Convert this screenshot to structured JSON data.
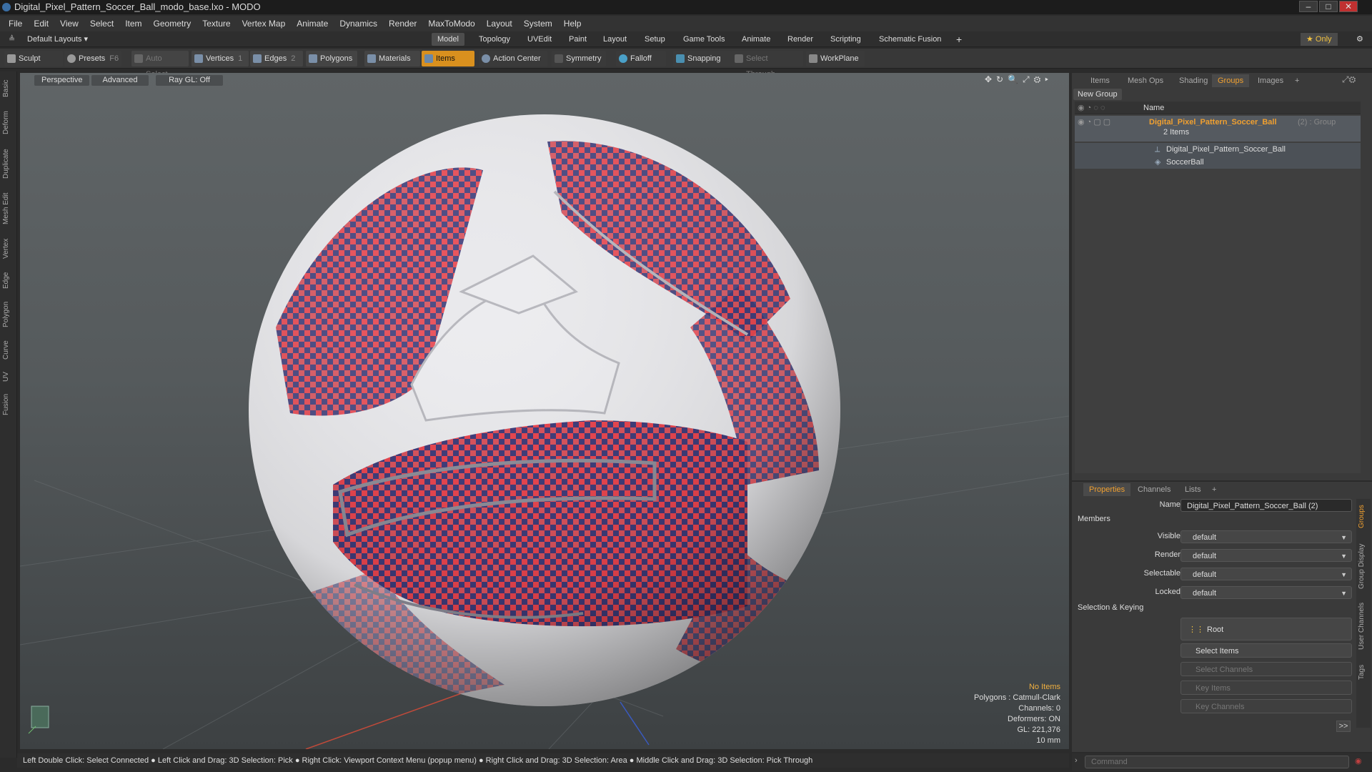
{
  "title": "Digital_Pixel_Pattern_Soccer_Ball_modo_base.lxo - MODO",
  "menu": [
    "File",
    "Edit",
    "View",
    "Select",
    "Item",
    "Geometry",
    "Texture",
    "Vertex Map",
    "Animate",
    "Dynamics",
    "Render",
    "MaxToModo",
    "Layout",
    "System",
    "Help"
  ],
  "layouts": {
    "default": "Default Layouts ▾",
    "only": "★ Only"
  },
  "layout_tabs": [
    "Model",
    "Topology",
    "UVEdit",
    "Paint",
    "Layout",
    "Setup",
    "Game Tools",
    "Animate",
    "Render",
    "Scripting",
    "Schematic Fusion",
    "+"
  ],
  "toolbar": {
    "sculpt": "Sculpt",
    "presets": "Presets",
    "presets_key": "F6",
    "auto_select": "Auto Select",
    "vertices": "Vertices",
    "vertices_count": "1",
    "edges": "Edges",
    "edges_count": "2",
    "polygons": "Polygons",
    "materials": "Materials",
    "items": "Items",
    "action_center": "Action Center",
    "symmetry": "Symmetry",
    "falloff": "Falloff",
    "snapping": "Snapping",
    "select_through": "Select Through",
    "workplane": "WorkPlane"
  },
  "left_tabs": [
    "Basic",
    "Deform",
    "Duplicate",
    "Mesh Edit",
    "Vertex",
    "Edge",
    "Polygon",
    "Curve",
    "UV",
    "Fusion"
  ],
  "viewport": {
    "view": "Perspective",
    "shading": "Advanced",
    "raygl": "Ray GL: Off",
    "hud": {
      "selection": "No Items",
      "polygons": "Polygons : Catmull-Clark",
      "channels": "Channels: 0",
      "deformers": "Deformers: ON",
      "gl": "GL: 221,376",
      "unit": "10 mm"
    }
  },
  "status": "Left Double Click: Select Connected ● Left Click and Drag: 3D Selection: Pick ● Right Click: Viewport Context Menu (popup menu) ● Right Click and Drag: 3D Selection: Area ● Middle Click and Drag: 3D Selection: Pick Through",
  "right_tabs": [
    "Items",
    "Mesh Ops",
    "Shading",
    "Groups",
    "Images",
    "+"
  ],
  "groups": {
    "new_group": "New Group",
    "col_name": "Name",
    "group_name": "Digital_Pixel_Pattern_Soccer_Ball",
    "group_suffix": "(2) : Group",
    "group_count": "2 Items",
    "child1": "Digital_Pixel_Pattern_Soccer_Ball",
    "child2": "SoccerBall"
  },
  "props_tabs": [
    "Properties",
    "Channels",
    "Lists",
    "+"
  ],
  "props": {
    "name_label": "Name",
    "name_value": "Digital_Pixel_Pattern_Soccer_Ball (2)",
    "members": "Members",
    "visible_label": "Visible",
    "render_label": "Render",
    "selectable_label": "Selectable",
    "locked_label": "Locked",
    "default": "default",
    "sel_keying": "Selection & Keying",
    "root": "Root",
    "select_items": "Select Items",
    "select_channels": "Select Channels",
    "key_items": "Key Items",
    "key_channels": "Key Channels",
    "more": ">>"
  },
  "side_tabs": [
    "Groups",
    "Group Display",
    "User Channels",
    "Tags"
  ],
  "command_placeholder": "Command",
  "colors": {
    "accent": "#f0a030",
    "red": "#e8434d",
    "navy": "#3d3a78",
    "white": "#e9e9ec"
  }
}
